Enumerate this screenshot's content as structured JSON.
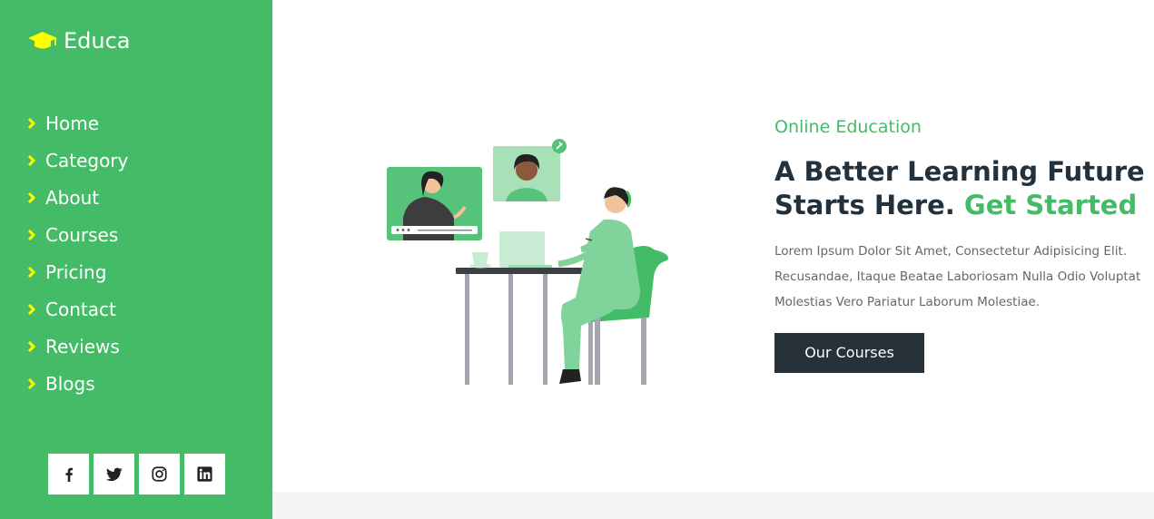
{
  "brand": {
    "name": "Educa",
    "icon": "graduation-cap-icon"
  },
  "colors": {
    "primary": "#44bb66",
    "dark": "#263238",
    "logo_icon": "#ffff00"
  },
  "nav": {
    "items": [
      {
        "label": "Home",
        "icon": "chevron-right-icon"
      },
      {
        "label": "Category",
        "icon": "chevron-right-icon"
      },
      {
        "label": "About",
        "icon": "chevron-right-icon"
      },
      {
        "label": "Courses",
        "icon": "chevron-right-icon"
      },
      {
        "label": "Pricing",
        "icon": "chevron-right-icon"
      },
      {
        "label": "Contact",
        "icon": "chevron-right-icon"
      },
      {
        "label": "Reviews",
        "icon": "chevron-right-icon"
      },
      {
        "label": "Blogs",
        "icon": "chevron-right-icon"
      }
    ]
  },
  "social": [
    "facebook-icon",
    "twitter-icon",
    "instagram-icon",
    "linkedin-icon"
  ],
  "hero": {
    "eyebrow": "Online Education",
    "headline_line1": "A Better Learning Future",
    "headline_line2": "Starts Here.",
    "headline_accent": "Get Started",
    "para_line1": "Lorem Ipsum Dolor Sit Amet, Consectetur Adipisicing Elit.",
    "para_line2": "Recusandae, Itaque Beatae Laboriosam Nulla Odio Voluptat",
    "para_line3": "Molestias Vero Pariatur Laborum Molestiae.",
    "cta_label": "Our Courses"
  }
}
